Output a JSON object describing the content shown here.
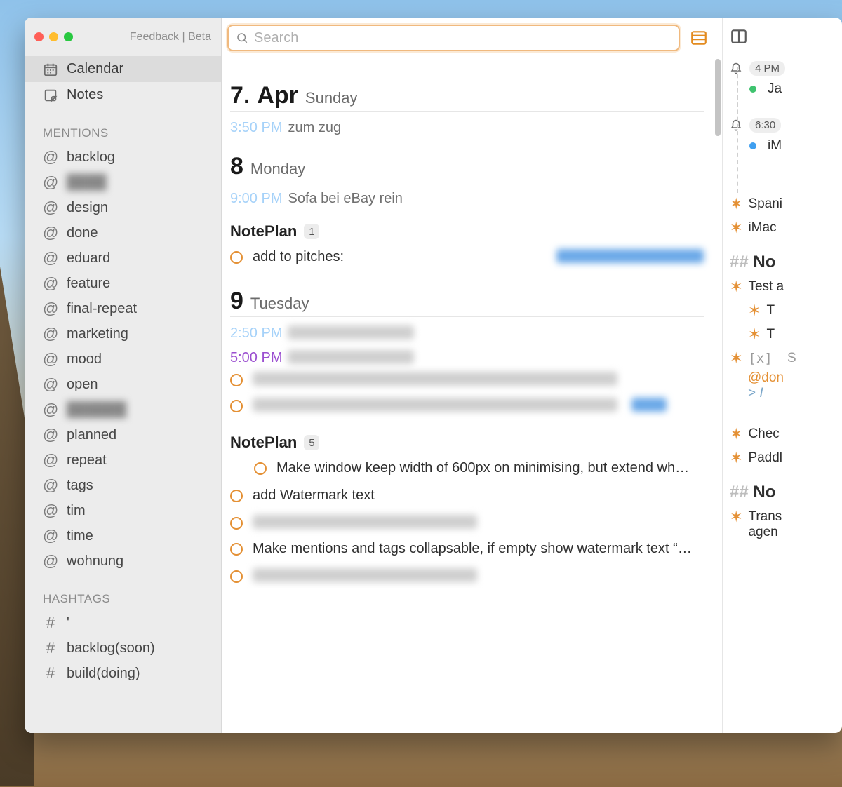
{
  "colors": {
    "accent": "#e49034",
    "search_border": "#f0b97e"
  },
  "titlebar": {
    "links": "Feedback | Beta"
  },
  "sidebar": {
    "nav": {
      "calendar": "Calendar",
      "notes": "Notes"
    },
    "mentions_label": "MENTIONS",
    "mentions": [
      {
        "label": "backlog"
      },
      {
        "label": "████",
        "blurred": true
      },
      {
        "label": "design"
      },
      {
        "label": "done"
      },
      {
        "label": "eduard"
      },
      {
        "label": "feature"
      },
      {
        "label": "final-repeat"
      },
      {
        "label": "marketing"
      },
      {
        "label": "mood"
      },
      {
        "label": "open"
      },
      {
        "label": "██████",
        "blurred": true
      },
      {
        "label": "planned"
      },
      {
        "label": "repeat"
      },
      {
        "label": "tags"
      },
      {
        "label": "tim"
      },
      {
        "label": "time"
      },
      {
        "label": "wohnung"
      }
    ],
    "hashtags_label": "HASHTAGS",
    "hashtags": [
      {
        "label": "'"
      },
      {
        "label": "backlog(soon)"
      },
      {
        "label": "build(doing)"
      }
    ]
  },
  "toolbar": {
    "search_placeholder": "Search"
  },
  "days": [
    {
      "num": "7.",
      "month": "Apr",
      "dow": "Sunday",
      "events": [
        {
          "time": "3:50 PM",
          "text": "zum zug"
        }
      ],
      "projects": []
    },
    {
      "num": "8",
      "dow": "Monday",
      "events": [
        {
          "time": "9:00 PM",
          "text": "Sofa bei eBay rein"
        }
      ],
      "projects": [
        {
          "name": "NotePlan",
          "count": "1",
          "tasks": [
            {
              "text": "add to pitches:",
              "link_blurred": true
            }
          ]
        }
      ]
    },
    {
      "num": "9",
      "dow": "Tuesday",
      "events": [
        {
          "time": "2:50 PM",
          "text_blurred": true
        },
        {
          "time": "5:00 PM",
          "text_blurred": true,
          "color": "purple"
        }
      ],
      "loose_tasks": [
        {
          "blurred": true
        },
        {
          "blurred": true,
          "trailing_link": true
        }
      ],
      "projects": [
        {
          "name": "NotePlan",
          "count": "5",
          "tasks": [
            {
              "text": "Make window keep width of 600px on minimising, but extend wh…",
              "indent": true
            },
            {
              "text": "add Watermark text"
            },
            {
              "blurred": true
            },
            {
              "text": "Make mentions and tags collapsable, if empty show watermark text “…"
            },
            {
              "blurred": true
            }
          ]
        }
      ]
    }
  ],
  "detail": {
    "alarms": [
      {
        "pill": "4 PM",
        "dot": "green",
        "label": "Ja"
      },
      {
        "pill": "6:30",
        "dot": "blue",
        "label": "iM"
      }
    ],
    "top_bullets": [
      {
        "text": "Spani"
      },
      {
        "text": "iMac"
      }
    ],
    "heading1": "No",
    "section1": {
      "b1": "Test a",
      "sub1": "T",
      "sub2": "T",
      "done_prefix": "[x]",
      "done_text": "S",
      "done_tag": "@don",
      "quote": "I"
    },
    "mid_bullets": [
      {
        "text": "Chec"
      },
      {
        "text": "Paddl"
      }
    ],
    "heading2": "No",
    "section2": {
      "b1": "Trans",
      "b1_line2": "agen"
    }
  }
}
